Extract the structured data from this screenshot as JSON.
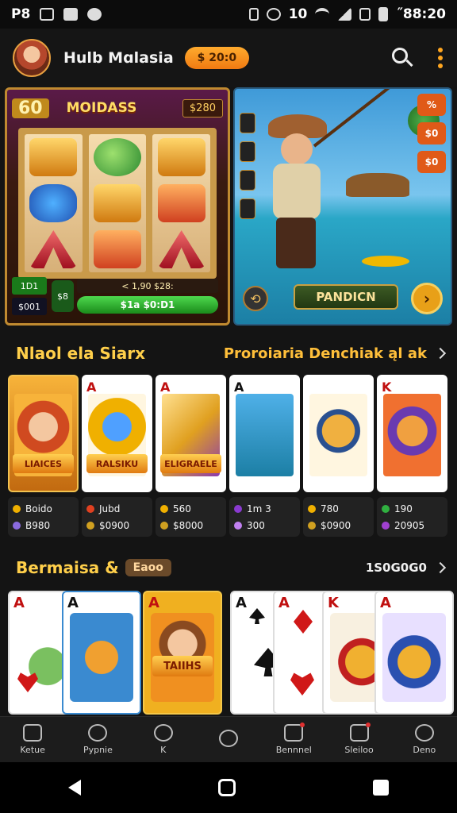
{
  "status": {
    "left_text": "P8",
    "time": "˝88:20",
    "battery_text": "10"
  },
  "header": {
    "title": "Hulb Mɑlasia",
    "coins": "$ 20:0"
  },
  "banner_slot": {
    "coin": "60",
    "title": "MOIDASS",
    "tag": "$280",
    "bet": "1D1",
    "balance": "$001",
    "mini": "$8",
    "info": "< 1,90 $28:",
    "spin": "$1a $0:D1"
  },
  "banner_fish": {
    "side_buttons": [
      "%",
      "$0",
      "$0"
    ],
    "action": "PANDICN",
    "left_btn": "⟲",
    "next_btn": "›"
  },
  "section1": {
    "title": "Nlaol ela Siarx",
    "subtitle": "Proroiaria Denchiak ąl ak"
  },
  "games1": [
    {
      "rank": "",
      "label": "LIAICES",
      "top": "Boido",
      "bottom": "B980"
    },
    {
      "rank": "A",
      "label": "RALSIKU",
      "top": "Jubd",
      "bottom": "$0900"
    },
    {
      "rank": "A",
      "label": "ELIGRAELE",
      "top": "560",
      "bottom": "$8000"
    },
    {
      "rank": "A",
      "label": "",
      "top": "1m 3",
      "bottom": "300"
    },
    {
      "rank": "",
      "label": "",
      "top": "780",
      "bottom": "$0900"
    },
    {
      "rank": "K",
      "label": "",
      "top": "190",
      "bottom": "20905"
    }
  ],
  "section2": {
    "title": "Bermaisa &",
    "badge": "Eaoo",
    "right": "1S0G0G0"
  },
  "games2": [
    {
      "rank": "A",
      "suit": "heart"
    },
    {
      "rank": "A",
      "suit": "spade"
    },
    {
      "rank": "A",
      "label": "TAIIHS"
    },
    {
      "rank": "A",
      "suit": "spade"
    },
    {
      "rank": "A",
      "suit": "diamond"
    },
    {
      "rank": "K",
      "suit": "diamond"
    },
    {
      "rank": "A",
      "suit": "heart"
    }
  ],
  "nav": [
    {
      "label": "Ketue"
    },
    {
      "label": "Pypnie"
    },
    {
      "label": "K"
    },
    {
      "label": ""
    },
    {
      "label": "Bennnel"
    },
    {
      "label": "Sleiloo"
    },
    {
      "label": "Deno"
    }
  ],
  "colors": {
    "accent": "#ffa620",
    "section_title": "#ffcf4a",
    "background": "#141414"
  }
}
